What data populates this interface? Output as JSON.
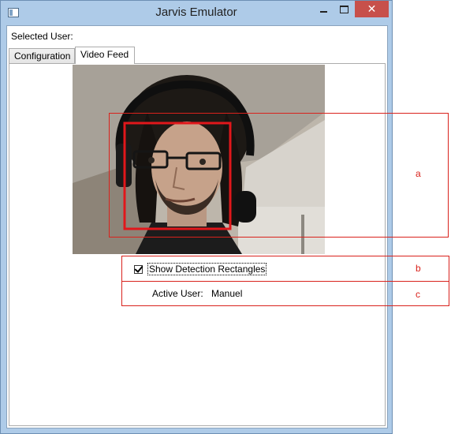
{
  "window": {
    "title": "Jarvis Emulator",
    "close_glyph": "✕"
  },
  "header": {
    "selected_user_label": "Selected User:"
  },
  "tabs": [
    {
      "label": "Configuration"
    },
    {
      "label": "Video Feed"
    }
  ],
  "video_feed": {
    "show_detection_label": "Show Detection Rectangles",
    "show_detection_checked": true
  },
  "active_user": {
    "label": "Active User:",
    "value": "Manuel"
  },
  "annotations": [
    {
      "letter": "a"
    },
    {
      "letter": "b"
    },
    {
      "letter": "c"
    }
  ],
  "colors": {
    "annotation": "#d9221c",
    "detection": "#e1171b",
    "close_button": "#c7504b"
  },
  "icons": {
    "app": "window-app-icon",
    "minimize": "minimize-icon",
    "maximize": "maximize-icon",
    "close": "close-icon",
    "check": "checkmark-icon"
  }
}
